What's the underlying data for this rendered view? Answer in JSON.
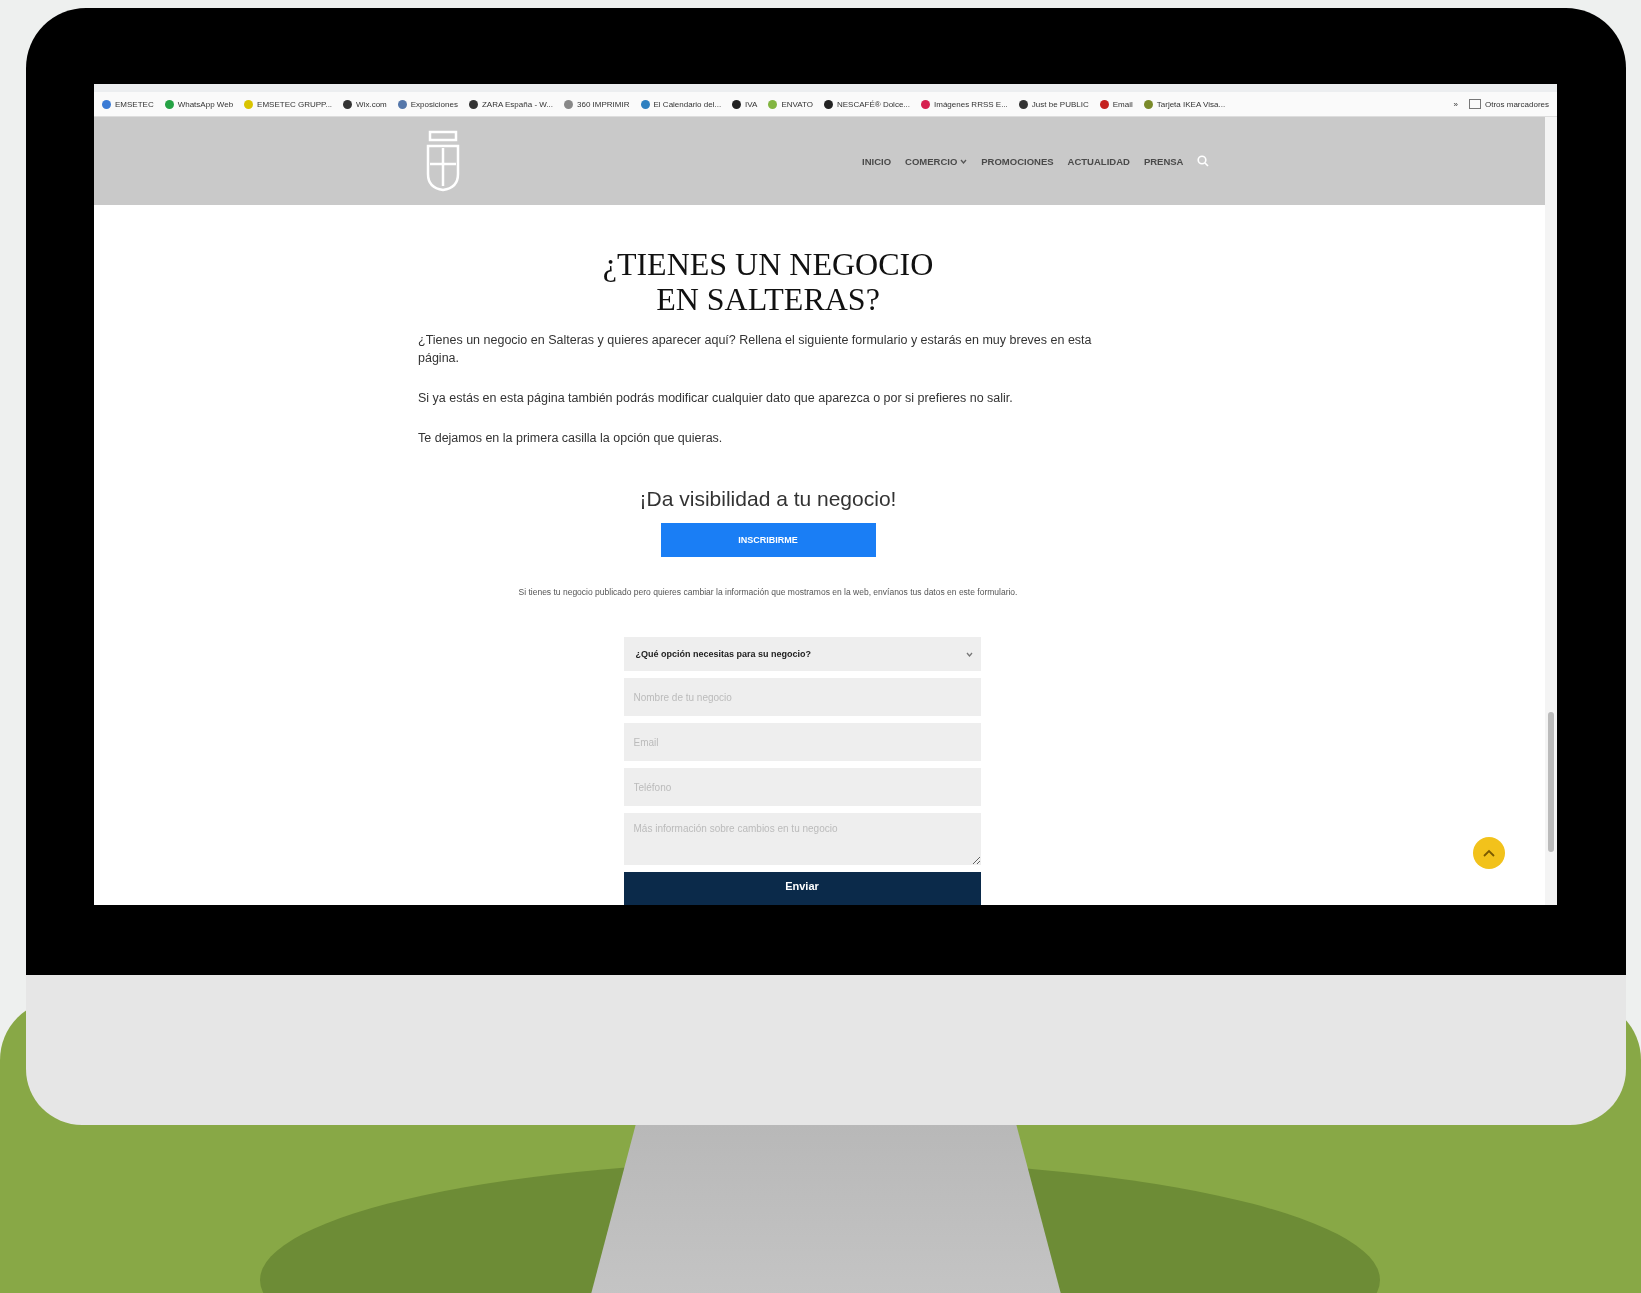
{
  "browser": {
    "bookmarks": [
      {
        "label": "EMSETEC",
        "color": "#3a7bd5"
      },
      {
        "label": "WhatsApp Web",
        "color": "#25a244"
      },
      {
        "label": "EMSETEC GRUPP...",
        "color": "#d9c400"
      },
      {
        "label": "Wix.com",
        "color": "#333333"
      },
      {
        "label": "Exposiciones",
        "color": "#5577aa"
      },
      {
        "label": "ZARA España - W...",
        "color": "#333333"
      },
      {
        "label": "360 IMPRIMIR",
        "color": "#888888"
      },
      {
        "label": "El Calendario del...",
        "color": "#2f80c0"
      },
      {
        "label": "IVA",
        "color": "#222222"
      },
      {
        "label": "ENVATO",
        "color": "#82b541"
      },
      {
        "label": "NESCAFÉ® Dolce...",
        "color": "#222222"
      },
      {
        "label": "Imágenes RRSS E...",
        "color": "#d6204f"
      },
      {
        "label": "Just be PUBLIC",
        "color": "#333333"
      },
      {
        "label": "Email",
        "color": "#c5221f"
      },
      {
        "label": "Tarjeta IKEA Visa...",
        "color": "#7a8a2a"
      }
    ],
    "more": "»",
    "other": "Otros marcadores"
  },
  "site": {
    "nav": [
      {
        "label": "INICIO",
        "has_dropdown": false
      },
      {
        "label": "COMERCIO",
        "has_dropdown": true
      },
      {
        "label": "PROMOCIONES",
        "has_dropdown": false
      },
      {
        "label": "ACTUALIDAD",
        "has_dropdown": false
      },
      {
        "label": "PRENSA",
        "has_dropdown": false
      }
    ]
  },
  "title": "¿TIENES UN NEGOCIO EN SALTERAS?",
  "paragraphs": [
    "¿Tienes un negocio en Salteras y quieres aparecer aquí? Rellena el siguiente formulario y estarás en muy breves en esta página.",
    "Si ya estás en esta página también podrás modificar cualquier dato que aparezca o por si prefieres no salir.",
    "Te dejamos en la primera casilla la opción que quieras."
  ],
  "cta": {
    "heading": "¡Da visibilidad a tu negocio!",
    "button": "INSCRIBIRME",
    "note": "Si tienes tu negocio publicado pero quieres cambiar la información que mostramos en la web, envíanos tus datos en este formulario."
  },
  "form": {
    "select": "¿Qué opción necesitas para su negocio?",
    "fields": [
      {
        "kind": "input",
        "placeholder": "Nombre de tu negocio"
      },
      {
        "kind": "input",
        "placeholder": "Email"
      },
      {
        "kind": "input",
        "placeholder": "Teléfono"
      },
      {
        "kind": "textarea",
        "placeholder": "Más información sobre cambios en tu negocio"
      }
    ],
    "submit": "Enviar"
  }
}
